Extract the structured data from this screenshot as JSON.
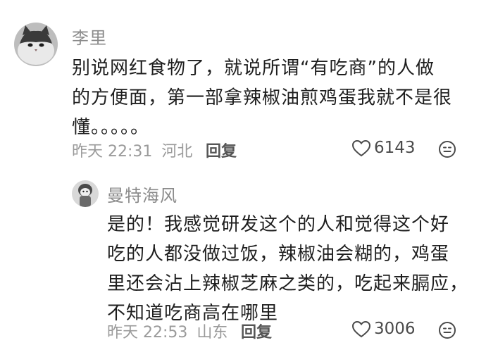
{
  "comment": {
    "username": "李里",
    "text_lines": [
      "别说网红食物了，就说所谓“有吃商”的人做",
      "的方便面，第一部拿辣椒油煎鸡蛋我就不是很",
      "懂。。。。。"
    ],
    "time": "昨天 22:31",
    "location": "河北",
    "reply_label": "回复",
    "like_count": "6143"
  },
  "reply": {
    "username": "曼特海风",
    "text_lines": [
      "是的！我感觉研发这个的人和觉得这个好",
      "吃的人都没做过饭，辣椒油会糊的，鸡蛋",
      "里还会沾上辣椒芝麻之类的，吃起来膈应，",
      "不知道吃商高在哪里"
    ],
    "time": "昨天 22:53",
    "location": "山东",
    "reply_label": "回复",
    "like_count": "3006"
  },
  "icons": {
    "like": "heart-outline-icon",
    "more": "emoji-face-icon"
  }
}
